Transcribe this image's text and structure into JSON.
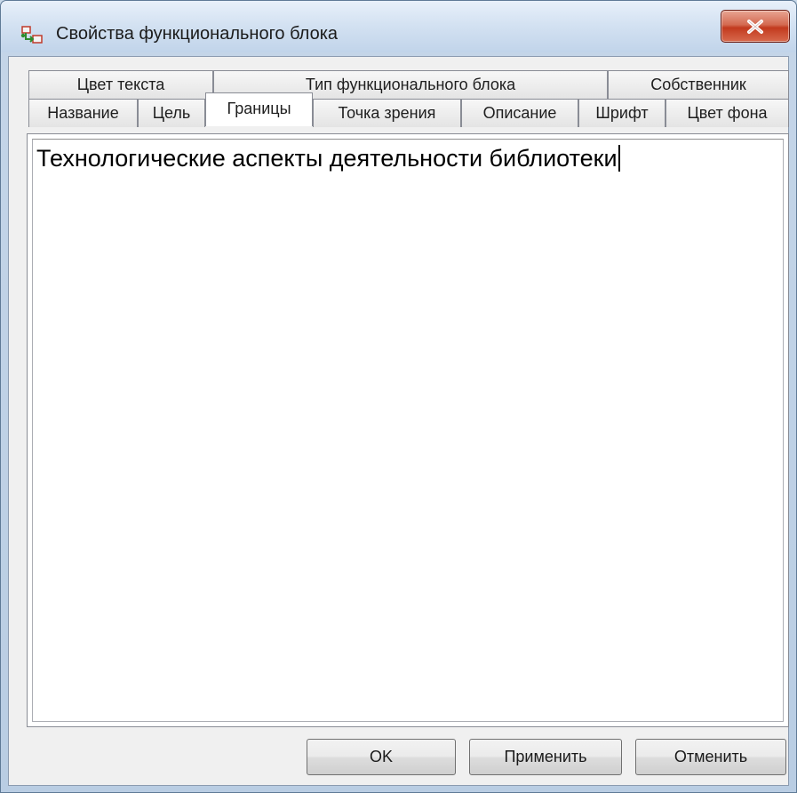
{
  "window": {
    "title": "Свойства функционального блока",
    "icon": "functional-block-icon",
    "close_icon": "close-icon"
  },
  "tabs": {
    "row_top": [
      {
        "label": "Цвет текста"
      },
      {
        "label": "Тип функционального блока"
      },
      {
        "label": "Собственник"
      }
    ],
    "row_bottom": [
      {
        "label": "Название"
      },
      {
        "label": "Цель"
      },
      {
        "label": "Границы",
        "selected": true
      },
      {
        "label": "Точка зрения"
      },
      {
        "label": "Описание"
      },
      {
        "label": "Шрифт"
      },
      {
        "label": "Цвет фона"
      }
    ]
  },
  "editor": {
    "value": "Технологические аспекты деятельности библиотеки"
  },
  "buttons": {
    "ok": "OK",
    "apply": "Применить",
    "cancel": "Отменить"
  },
  "colors": {
    "close_button": "#c23a1e",
    "titlebar": "#d4e2f2",
    "dialog_background": "#f0f0f0"
  }
}
